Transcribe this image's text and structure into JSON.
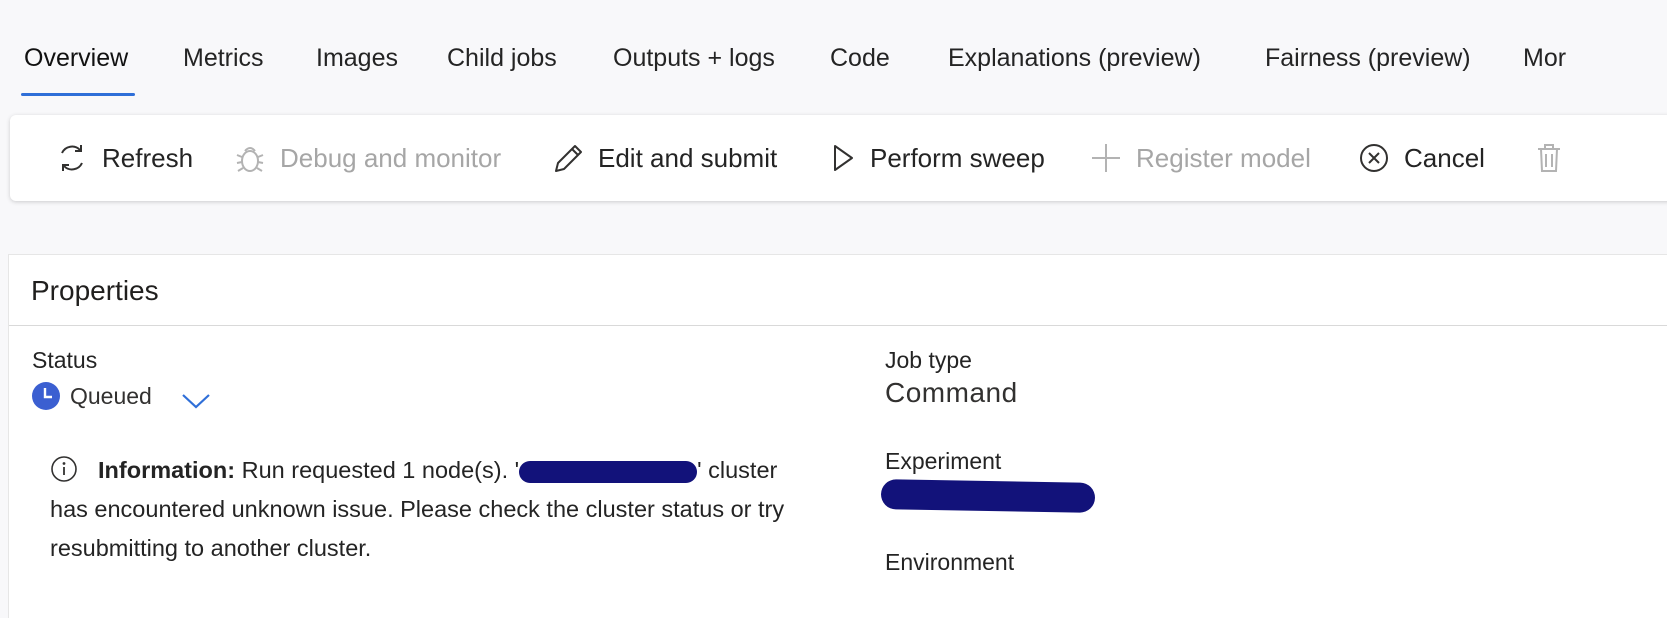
{
  "tabs": {
    "items": [
      {
        "label": "Overview"
      },
      {
        "label": "Metrics"
      },
      {
        "label": "Images"
      },
      {
        "label": "Child jobs"
      },
      {
        "label": "Outputs + logs"
      },
      {
        "label": "Code"
      },
      {
        "label": "Explanations (preview)"
      },
      {
        "label": "Fairness (preview)"
      },
      {
        "label": "Mor"
      }
    ],
    "active_index": 0
  },
  "toolbar": {
    "refresh": "Refresh",
    "debug": "Debug and monitor",
    "edit_submit": "Edit and submit",
    "perform_sweep": "Perform sweep",
    "register_model": "Register model",
    "cancel": "Cancel"
  },
  "properties": {
    "title": "Properties",
    "status_label": "Status",
    "status_value": "Queued",
    "info_label": "Information:",
    "info_text_1": "Run requested 1 node(s). '",
    "info_text_1b": "' cluster",
    "info_text_2": "has encountered unknown issue. Please check the cluster status or try",
    "info_text_3": "resubmitting to another cluster.",
    "job_type_label": "Job type",
    "job_type_value": "Command",
    "experiment_label": "Experiment",
    "environment_label": "Environment"
  },
  "colors": {
    "accent": "#2f6fd8",
    "status_icon": "#3b5fd1",
    "redaction": "#12127a"
  }
}
